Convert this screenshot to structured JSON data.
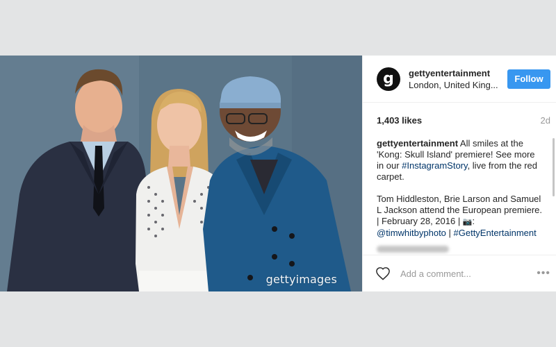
{
  "post": {
    "photo": {
      "alt": "Tom Hiddleston, Brie Larson and Samuel L Jackson at premiere",
      "watermark": "gettyimages"
    },
    "header": {
      "avatar_letter": "g",
      "username": "gettyentertainment",
      "location": "London, United King...",
      "follow_label": "Follow"
    },
    "stats": {
      "likes": "1,403 likes",
      "time": "2d"
    },
    "caption": {
      "username": "gettyentertainment",
      "p1_a": " All smiles at the 'Kong: Skull Island' premiere! See more in our ",
      "p1_tag": "#InstagramStory",
      "p1_b": ", live from the red carpet.",
      "p2_a": "Tom Hiddleston, Brie Larson and Samuel L Jackson attend the European premiere. | February 28, 2016 | ",
      "camera_emoji": "📷",
      "p2_b": ": ",
      "p2_mention": "@timwhitbyphoto",
      "p2_sep": " | ",
      "p2_tag": "#GettyEntertainment"
    },
    "comment": {
      "placeholder": "Add a comment...",
      "more_label": "•••"
    }
  },
  "colors": {
    "accent": "#3897f0",
    "link": "#003569",
    "page_bg": "#e3e4e5"
  }
}
